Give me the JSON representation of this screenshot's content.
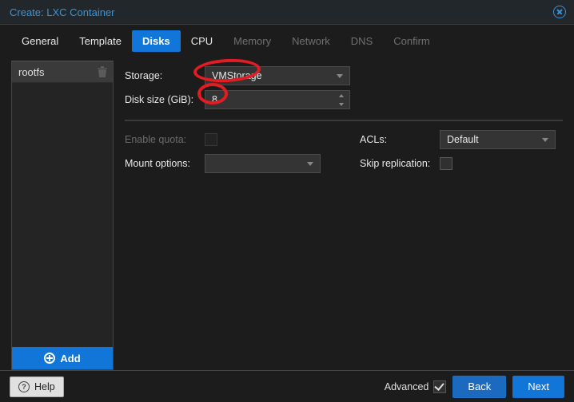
{
  "title": "Create: LXC Container",
  "tabs": [
    {
      "label": "General",
      "state": ""
    },
    {
      "label": "Template",
      "state": ""
    },
    {
      "label": "Disks",
      "state": "active"
    },
    {
      "label": "CPU",
      "state": ""
    },
    {
      "label": "Memory",
      "state": "disabled"
    },
    {
      "label": "Network",
      "state": "disabled"
    },
    {
      "label": "DNS",
      "state": "disabled"
    },
    {
      "label": "Confirm",
      "state": "disabled"
    }
  ],
  "side": {
    "item": "rootfs",
    "add": "Add"
  },
  "form": {
    "storage_label": "Storage:",
    "storage_value": "VMStorage",
    "disk_label": "Disk size (GiB):",
    "disk_value": "8",
    "quota_label": "Enable quota:",
    "acls_label": "ACLs:",
    "acls_value": "Default",
    "mount_label": "Mount options:",
    "mount_value": "",
    "skip_label": "Skip replication:"
  },
  "footer": {
    "help": "Help",
    "advanced": "Advanced",
    "back": "Back",
    "next": "Next"
  }
}
